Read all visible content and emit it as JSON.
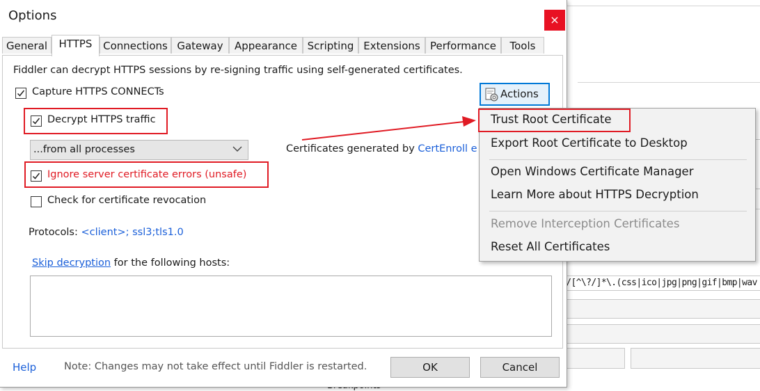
{
  "dialog": {
    "title": "Options",
    "close_glyph": "×"
  },
  "tabs": [
    {
      "label": "General",
      "active": false
    },
    {
      "label": "HTTPS",
      "active": true
    },
    {
      "label": "Connections",
      "active": false
    },
    {
      "label": "Gateway",
      "active": false
    },
    {
      "label": "Appearance",
      "active": false
    },
    {
      "label": "Scripting",
      "active": false
    },
    {
      "label": "Extensions",
      "active": false
    },
    {
      "label": "Performance",
      "active": false
    },
    {
      "label": "Tools",
      "active": false
    }
  ],
  "https": {
    "intro": "Fiddler can decrypt HTTPS sessions by re-signing traffic using self-generated certificates.",
    "capture_connects": {
      "label": "Capture HTTPS CONNECTs",
      "checked": true
    },
    "decrypt_traffic": {
      "label": "Decrypt HTTPS traffic",
      "checked": true
    },
    "process_filter": {
      "selected": "...from all processes"
    },
    "cert_generator_prefix": "Certificates generated by ",
    "cert_generator_link": "CertEnroll e",
    "ignore_errors": {
      "label": "Ignore server certificate errors (unsafe)",
      "checked": true
    },
    "check_revocation": {
      "label": "Check for certificate revocation",
      "checked": false
    },
    "protocols_label": "Protocols: ",
    "protocols_value": "<client>; ssl3;tls1.0",
    "skip_link": "Skip decryption",
    "skip_suffix": " for the following hosts:",
    "hosts_value": ""
  },
  "actions_button": {
    "label": "Actions",
    "icon": "certificate-gear-icon"
  },
  "actions_menu": {
    "items": [
      {
        "label": "Trust Root Certificate",
        "enabled": true
      },
      {
        "label": "Export Root Certificate to Desktop",
        "enabled": true
      },
      {
        "label": "Open Windows Certificate Manager",
        "enabled": true
      },
      {
        "label": "Learn More about HTTPS Decryption",
        "enabled": true
      },
      {
        "label": "Remove Interception Certificates",
        "enabled": false
      },
      {
        "label": "Reset All Certificates",
        "enabled": true
      }
    ]
  },
  "footer": {
    "help": "Help",
    "note": "Note: Changes may not take effect until Fiddler is restarted.",
    "ok": "OK",
    "cancel": "Cancel"
  },
  "background": {
    "regex_text": ")/[^\\?/]*\\.(css|ico|jpg|png|gif|bmp|wav",
    "breakpoints_label": "Breakpoints"
  },
  "colors": {
    "annotation_red": "#e01b24",
    "link_blue": "#1a5fd9",
    "focus_blue": "#0078d7",
    "close_red": "#e81123"
  }
}
